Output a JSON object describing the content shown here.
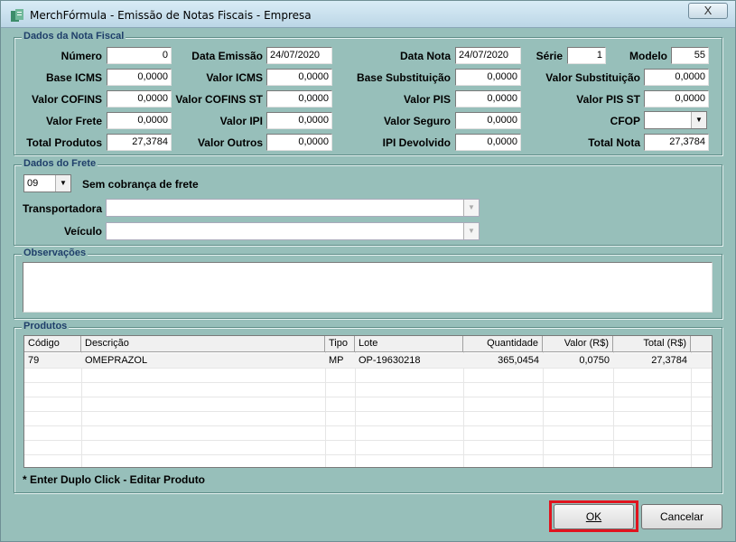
{
  "window": {
    "title": "MerchFórmula  - Emissão de Notas Fiscais - Empresa",
    "close_glyph": "X"
  },
  "nota": {
    "legend": "Dados da Nota Fiscal",
    "numero_label": "Número",
    "numero": "0",
    "data_emissao_label": "Data Emissão",
    "data_emissao": "24/07/2020",
    "data_nota_label": "Data Nota",
    "data_nota": "24/07/2020",
    "serie_label": "Série",
    "serie": "1",
    "modelo_label": "Modelo",
    "modelo": "55",
    "base_icms_label": "Base ICMS",
    "base_icms": "0,0000",
    "valor_icms_label": "Valor ICMS",
    "valor_icms": "0,0000",
    "base_subst_label": "Base Substituição",
    "base_subst": "0,0000",
    "valor_subst_label": "Valor Substituição",
    "valor_subst": "0,0000",
    "valor_cofins_label": "Valor COFINS",
    "valor_cofins": "0,0000",
    "valor_cofins_st_label": "Valor COFINS ST",
    "valor_cofins_st": "0,0000",
    "valor_pis_label": "Valor PIS",
    "valor_pis": "0,0000",
    "valor_pis_st_label": "Valor PIS ST",
    "valor_pis_st": "0,0000",
    "valor_frete_label": "Valor Frete",
    "valor_frete": "0,0000",
    "valor_ipi_label": "Valor IPI",
    "valor_ipi": "0,0000",
    "valor_seguro_label": "Valor Seguro",
    "valor_seguro": "0,0000",
    "cfop_label": "CFOP",
    "cfop": "",
    "total_produtos_label": "Total Produtos",
    "total_produtos": "27,3784",
    "valor_outros_label": "Valor Outros",
    "valor_outros": "0,0000",
    "ipi_devolvido_label": "IPI Devolvido",
    "ipi_devolvido": "0,0000",
    "total_nota_label": "Total Nota",
    "total_nota": "27,3784"
  },
  "frete": {
    "legend": "Dados do Frete",
    "modalidade": "09",
    "modalidade_desc": "Sem cobrança de frete",
    "transportadora_label": "Transportadora",
    "transportadora": "",
    "veiculo_label": "Veículo",
    "veiculo": ""
  },
  "observacoes": {
    "legend": "Observações",
    "text": ""
  },
  "produtos": {
    "legend": "Produtos",
    "columns": [
      "Código",
      "Descrição",
      "Tipo",
      "Lote",
      "Quantidade",
      "Valor (R$)",
      "Total (R$)"
    ],
    "rows": [
      {
        "codigo": "79",
        "descricao": "OMEPRAZOL",
        "tipo": "MP",
        "lote": "OP-19630218",
        "quantidade": "365,0454",
        "valor": "0,0750",
        "total": "27,3784"
      }
    ],
    "hint": "* Enter Duplo Click - Editar Produto"
  },
  "buttons": {
    "ok": "OK",
    "cancelar": "Cancelar"
  },
  "colors": {
    "accent_highlight": "#e0141e",
    "window_bg": "#97bfba",
    "legend_text": "#1f3f6a"
  }
}
